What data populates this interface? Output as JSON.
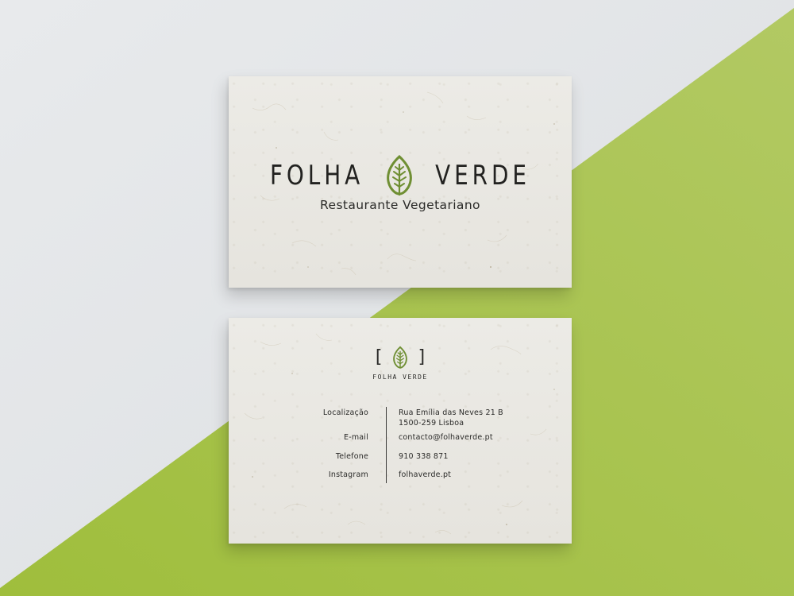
{
  "colors": {
    "background_light": "#e6e8ea",
    "background_green": "#a9c44f",
    "card": "#e9e7e1",
    "ink": "#222220",
    "leaf_green": "#6f8f33"
  },
  "front": {
    "brand_left": "FOLHA",
    "brand_right": "VERDE",
    "leaf_icon": "leaf-icon",
    "tagline": "Restaurante Vegetariano"
  },
  "back": {
    "bracket_left": "[",
    "bracket_right": "]",
    "brand_small": "FOLHA VERDE",
    "contact": {
      "location_label": "Localização",
      "location_line1": "Rua Emília das Neves 21 B",
      "location_line2": "1500-259 Lisboa",
      "email_label": "E-mail",
      "email_value": "contacto@folhaverde.pt",
      "phone_label": "Telefone",
      "phone_value": "910 338 871",
      "instagram_label": "Instagram",
      "instagram_value": "folhaverde.pt"
    }
  }
}
